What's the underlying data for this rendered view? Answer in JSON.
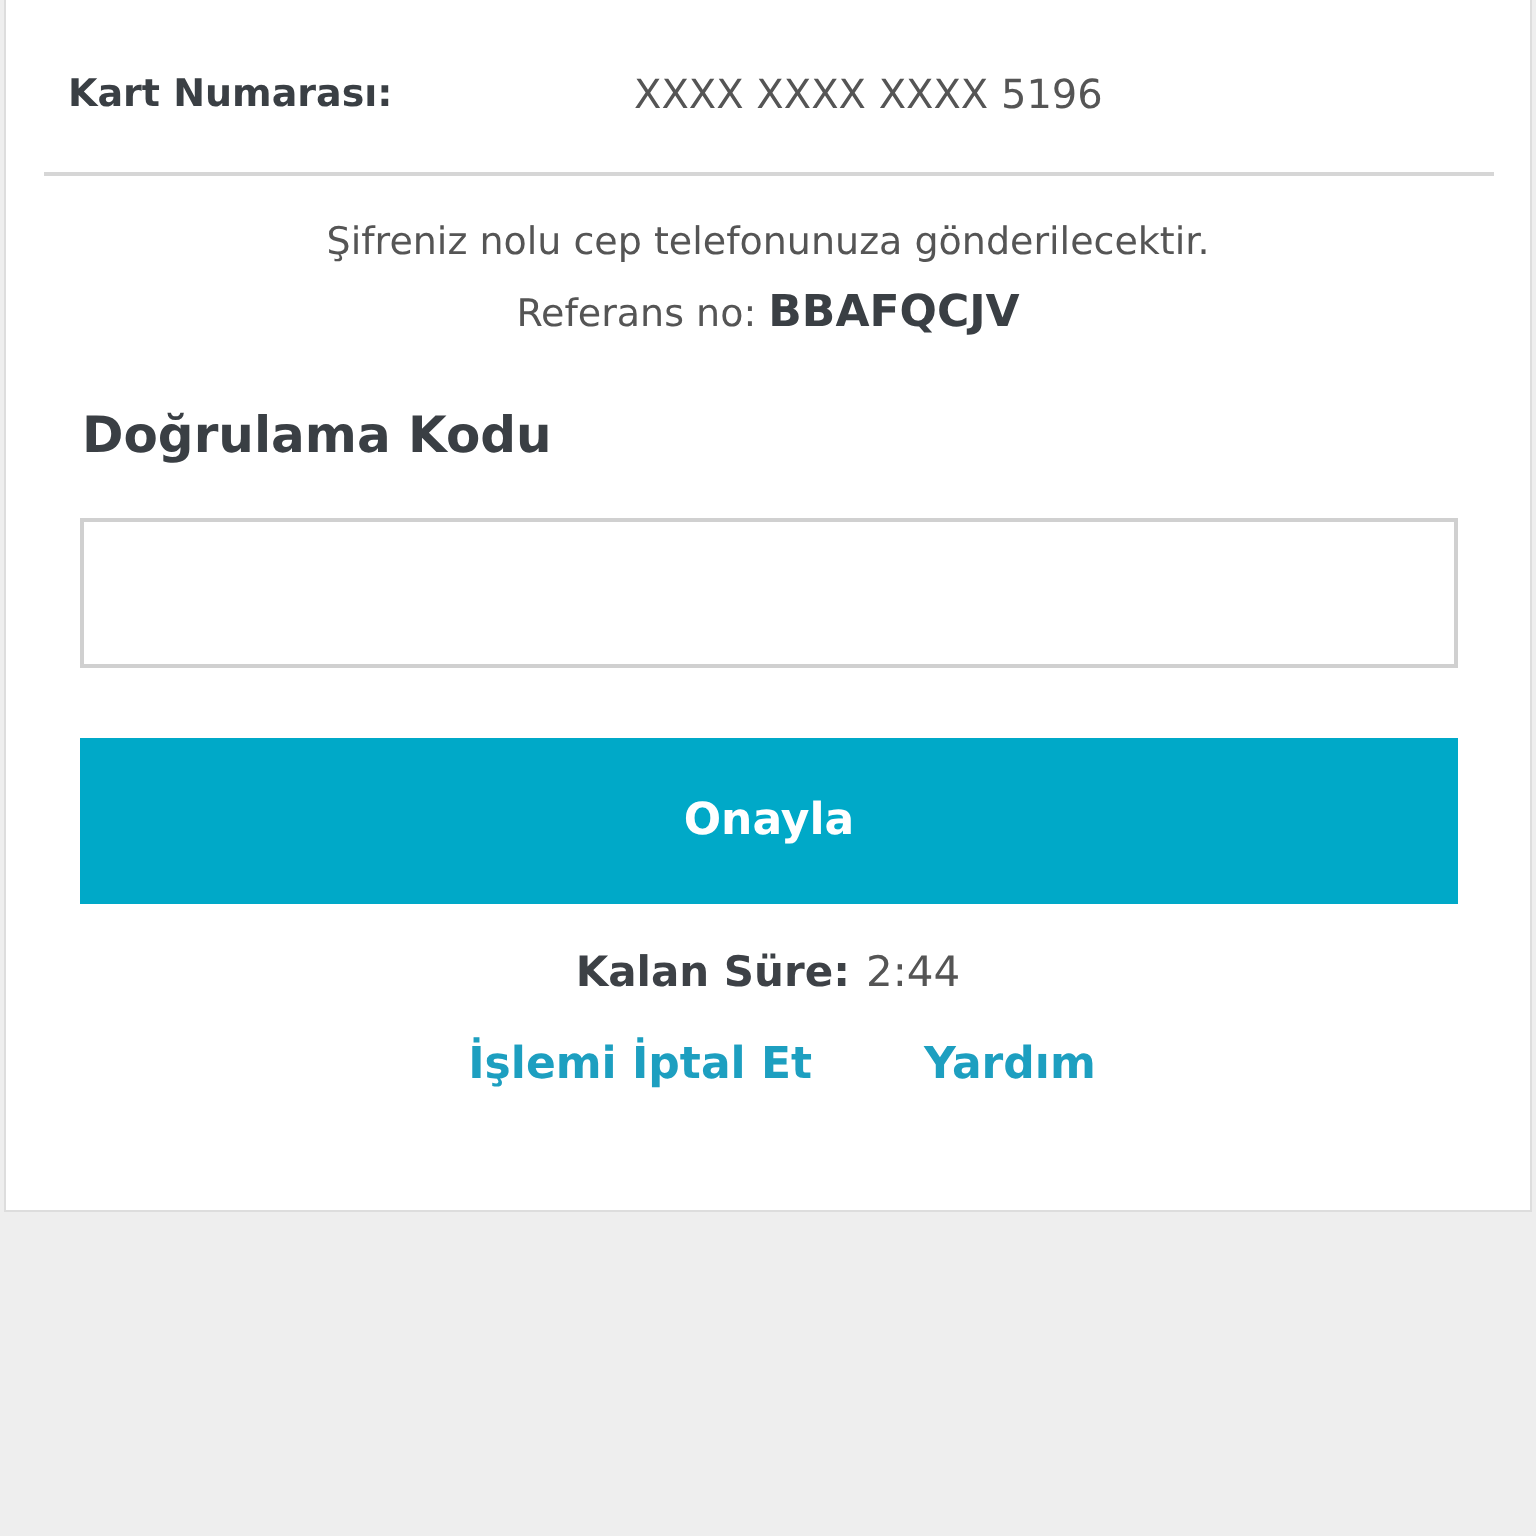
{
  "details": [
    {
      "label": "Kart Numarası:",
      "value": "XXXX XXXX XXXX 5196"
    }
  ],
  "info": "Şifreniz nolu cep telefonunuza gönderilecektir.",
  "reference": "Referans no: **BBAFQCJV**",
  "code_field": {
    "label": "Doğrulama Kodu"
  },
  "confirm_button": "Onayla",
  "timer": {
    "label": "Kalan Süre:",
    "value": "2:44"
  },
  "links": [
    "İşlemi İptal Et",
    "Yardım"
  ]
}
